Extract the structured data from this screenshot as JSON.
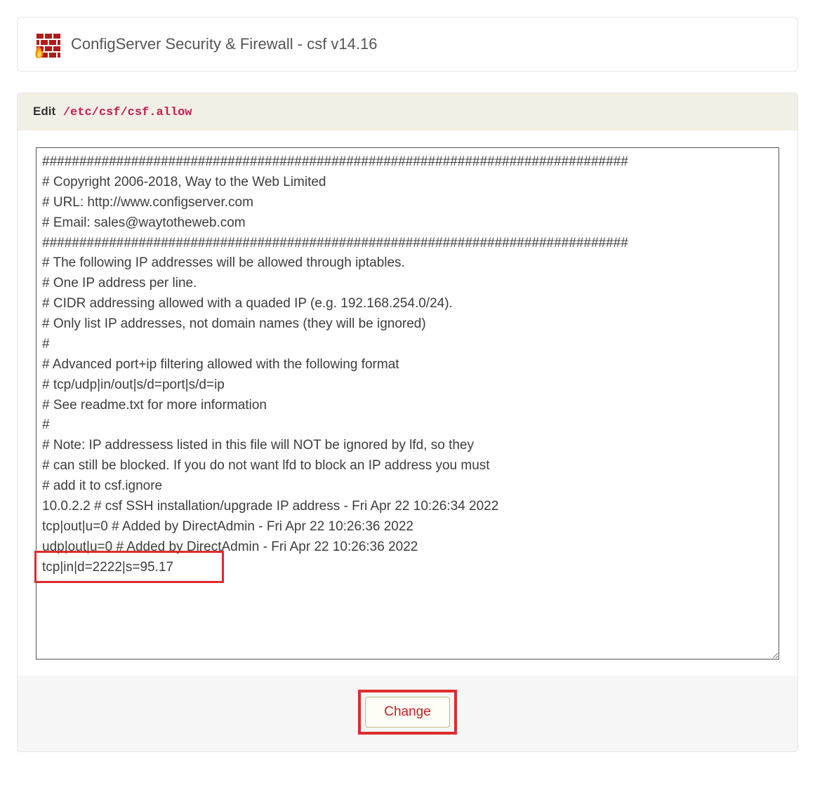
{
  "header": {
    "title": "ConfigServer Security & Firewall - csf v14.16",
    "icon_name": "firewall-icon"
  },
  "editor": {
    "label": "Edit",
    "file_path": "/etc/csf/csf.allow",
    "content": "###############################################################################\n# Copyright 2006-2018, Way to the Web Limited\n# URL: http://www.configserver.com\n# Email: sales@waytotheweb.com\n###############################################################################\n# The following IP addresses will be allowed through iptables.\n# One IP address per line.\n# CIDR addressing allowed with a quaded IP (e.g. 192.168.254.0/24).\n# Only list IP addresses, not domain names (they will be ignored)\n#\n# Advanced port+ip filtering allowed with the following format\n# tcp/udp|in/out|s/d=port|s/d=ip\n# See readme.txt for more information\n#\n# Note: IP addressess listed in this file will NOT be ignored by lfd, so they\n# can still be blocked. If you do not want lfd to block an IP address you must\n# add it to csf.ignore\n10.0.2.2 # csf SSH installation/upgrade IP address - Fri Apr 22 10:26:34 2022\ntcp|out|u=0 # Added by DirectAdmin - Fri Apr 22 10:26:36 2022\nudp|out|u=0 # Added by DirectAdmin - Fri Apr 22 10:26:36 2022\ntcp|in|d=2222|s=95.17"
  },
  "footer": {
    "change_label": "Change"
  },
  "annotations": {
    "highlight_color": "#de2c2c"
  }
}
